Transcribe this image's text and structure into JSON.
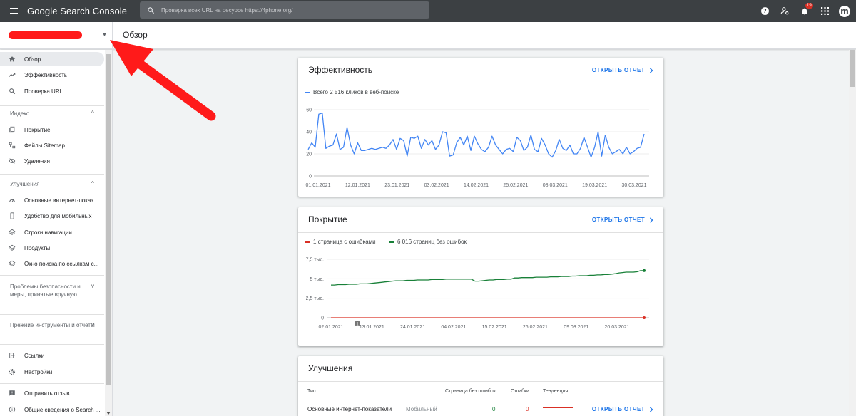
{
  "topbar": {
    "brand": "Google Search Console",
    "search_placeholder": "Проверка всех URL на ресурсе https://4phone.org/",
    "notifications_count": "19",
    "avatar_letter": "m"
  },
  "header": {
    "page_title": "Обзор"
  },
  "sidebar": {
    "items": [
      {
        "label": "Обзор",
        "icon": "home-icon"
      },
      {
        "label": "Эффективность",
        "icon": "trending-up-icon"
      },
      {
        "label": "Проверка URL",
        "icon": "search-icon"
      },
      {
        "label": "Покрытие",
        "icon": "coverage-icon"
      },
      {
        "label": "Файлы Sitemap",
        "icon": "sitemap-icon"
      },
      {
        "label": "Удаления",
        "icon": "removals-icon"
      },
      {
        "label": "Основные интернет-показ...",
        "icon": "vitals-icon"
      },
      {
        "label": "Удобство для мобильных",
        "icon": "mobile-icon"
      },
      {
        "label": "Строки навигации",
        "icon": "layers-icon"
      },
      {
        "label": "Продукты",
        "icon": "layers-icon"
      },
      {
        "label": "Окно поиска по ссылкам с...",
        "icon": "layers-icon"
      },
      {
        "label": "Ссылки",
        "icon": "links-icon"
      },
      {
        "label": "Настройки",
        "icon": "gear-icon"
      },
      {
        "label": "Отправить отзыв",
        "icon": "feedback-icon"
      },
      {
        "label": "Общие сведения о Search ...",
        "icon": "info-icon"
      }
    ],
    "sections": {
      "index": "Индекс",
      "enhancements": "Улучшения",
      "security": "Проблемы безопасности и меры, принятые вручную",
      "legacy": "Прежние инструменты и отчеты"
    }
  },
  "performance_card": {
    "title": "Эффективность",
    "link": "ОТКРЫТЬ ОТЧЕТ",
    "legend": "Всего 2 516 кликов в веб-поиске",
    "color": "#4285f4"
  },
  "coverage_card": {
    "title": "Покрытие",
    "link": "ОТКРЫТЬ ОТЧЕТ",
    "legend_errors": "1 страница с ошибками",
    "legend_valid": "6 016 страниц без ошибок",
    "error_color": "#d93025",
    "valid_color": "#188038",
    "annotation": "1"
  },
  "enhancements_card": {
    "title": "Улучшения",
    "columns": [
      "Тип",
      "Страница без ошибок",
      "Ошибки",
      "Тенденция"
    ],
    "rows": [
      {
        "type": "Основные интернет-показатели",
        "device": "Мобильный",
        "valid": "0",
        "errors": "0",
        "link": "ОТКРЫТЬ ОТЧЕТ"
      }
    ]
  },
  "chart_data": [
    {
      "type": "line",
      "title": "",
      "series": [
        {
          "name": "Всего 2 516 кликов в веб-поиске",
          "values": [
            24,
            30,
            26,
            56,
            57,
            25,
            27,
            28,
            38,
            24,
            26,
            44,
            28,
            20,
            30,
            23,
            23,
            24,
            25,
            24,
            25,
            26,
            25,
            28,
            33,
            24,
            34,
            32,
            18,
            35,
            34,
            36,
            25,
            33,
            28,
            32,
            24,
            28,
            40,
            39,
            18,
            19,
            30,
            35,
            28,
            36,
            23,
            36,
            29,
            24,
            22,
            26,
            36,
            28,
            24,
            20,
            24,
            25,
            22,
            35,
            32,
            23,
            26,
            37,
            24,
            22,
            34,
            28,
            20,
            17,
            23,
            33,
            25,
            23,
            28,
            20,
            20,
            25,
            35,
            26,
            17,
            26,
            40,
            18,
            37,
            26,
            20,
            22,
            24,
            20,
            26,
            20,
            22,
            25,
            26,
            38
          ]
        }
      ],
      "x_tick_labels": [
        "01.01.2021",
        "12.01.2021",
        "23.01.2021",
        "03.02.2021",
        "14.02.2021",
        "25.02.2021",
        "08.03.2021",
        "19.03.2021",
        "30.03.2021"
      ],
      "y_ticks": [
        "60",
        "40",
        "20",
        "0"
      ],
      "ylim": [
        0,
        60
      ],
      "grid": true
    },
    {
      "type": "line",
      "title": "",
      "series": [
        {
          "name": "1 страница с ошибками",
          "values": [
            0,
            0,
            0,
            0,
            0,
            0,
            0,
            0,
            0,
            0,
            0,
            0,
            0,
            0,
            0,
            0,
            0,
            0,
            0,
            0,
            0,
            0,
            0,
            0,
            0,
            0,
            0,
            0,
            0,
            0,
            0,
            0,
            0,
            0,
            0,
            0,
            0,
            0,
            0,
            0,
            0,
            0,
            0,
            0,
            0,
            0,
            0,
            0,
            0,
            0,
            0,
            0,
            0,
            0,
            0,
            0,
            0,
            0,
            0,
            0,
            0,
            0,
            0,
            0,
            0,
            0,
            0,
            0,
            0,
            0,
            0,
            0,
            0,
            0,
            0,
            0,
            0,
            0,
            0,
            0,
            0,
            0,
            0,
            0,
            0,
            0,
            0,
            1
          ]
        },
        {
          "name": "6 016 страниц без ошибок",
          "values": [
            4200,
            4200,
            4250,
            4250,
            4250,
            4300,
            4300,
            4300,
            4350,
            4350,
            4350,
            4400,
            4450,
            4500,
            4550,
            4600,
            4650,
            4700,
            4750,
            4750,
            4750,
            4800,
            4800,
            4800,
            4850,
            4850,
            4850,
            4850,
            4900,
            4900,
            4900,
            4900,
            4950,
            4950,
            4950,
            4950,
            4950,
            4950,
            4950,
            4950,
            4700,
            4700,
            4750,
            4800,
            4850,
            4850,
            4900,
            4900,
            4900,
            4950,
            4950,
            5100,
            5100,
            5150,
            5150,
            5150,
            5150,
            5200,
            5200,
            5200,
            5200,
            5250,
            5250,
            5250,
            5300,
            5300,
            5300,
            5350,
            5350,
            5400,
            5400,
            5400,
            5450,
            5450,
            5500,
            5500,
            5550,
            5550,
            5600,
            5650,
            5750,
            5800,
            5850,
            5850,
            5850,
            5900,
            6050,
            6050
          ]
        }
      ],
      "x_tick_labels": [
        "02.01.2021",
        "13.01.2021",
        "24.01.2021",
        "04.02.2021",
        "15.02.2021",
        "26.02.2021",
        "09.03.2021",
        "20.03.2021"
      ],
      "y_ticks": [
        "7,5 тыс.",
        "5 тыс.",
        "2,5 тыс.",
        "0"
      ],
      "ylim": [
        0,
        7500
      ],
      "grid": true
    }
  ]
}
